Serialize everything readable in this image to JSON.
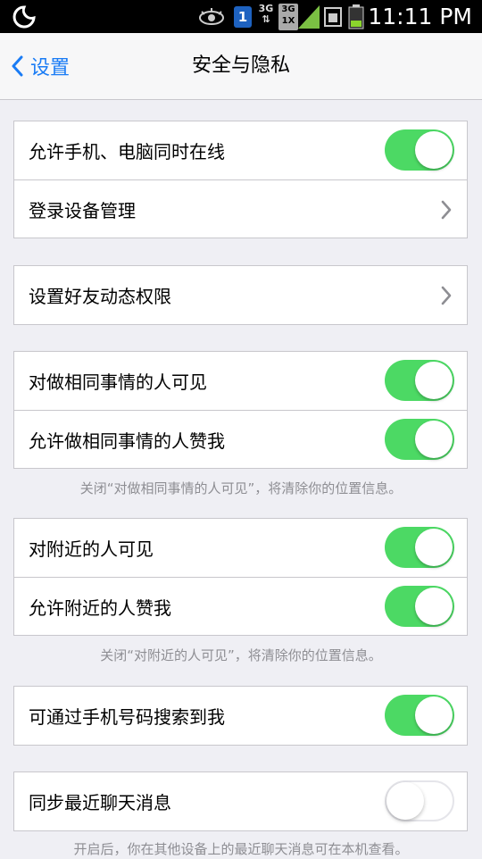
{
  "status_bar": {
    "time": "11:11 PM",
    "sim_slot": "1",
    "network_a": "3G",
    "network_b_top": "3G",
    "network_b_bottom": "1X"
  },
  "nav": {
    "back_label": "设置",
    "title": "安全与隐私"
  },
  "groups": [
    {
      "rows": [
        {
          "label": "允许手机、电脑同时在线",
          "control": "toggle",
          "on": true
        },
        {
          "label": "登录设备管理",
          "control": "chevron"
        }
      ]
    },
    {
      "rows": [
        {
          "label": "设置好友动态权限",
          "control": "chevron"
        }
      ]
    },
    {
      "rows": [
        {
          "label": "对做相同事情的人可见",
          "control": "toggle",
          "on": true
        },
        {
          "label": "允许做相同事情的人赞我",
          "control": "toggle",
          "on": true
        }
      ],
      "footnote": "关闭“对做相同事情的人可见”，将清除你的位置信息。"
    },
    {
      "rows": [
        {
          "label": "对附近的人可见",
          "control": "toggle",
          "on": true
        },
        {
          "label": "允许附近的人赞我",
          "control": "toggle",
          "on": true
        }
      ],
      "footnote": "关闭“对附近的人可见”，将清除你的位置信息。"
    },
    {
      "rows": [
        {
          "label": "可通过手机号码搜索到我",
          "control": "toggle",
          "on": true
        }
      ]
    },
    {
      "rows": [
        {
          "label": "同步最近聊天消息",
          "control": "toggle",
          "on": false
        }
      ],
      "footnote": "开启后，你在其他设备上的最近聊天消息可在本机查看。"
    }
  ],
  "colors": {
    "accent": "#1a7cf5",
    "toggle_on": "#4cd964",
    "background": "#efeff4"
  }
}
